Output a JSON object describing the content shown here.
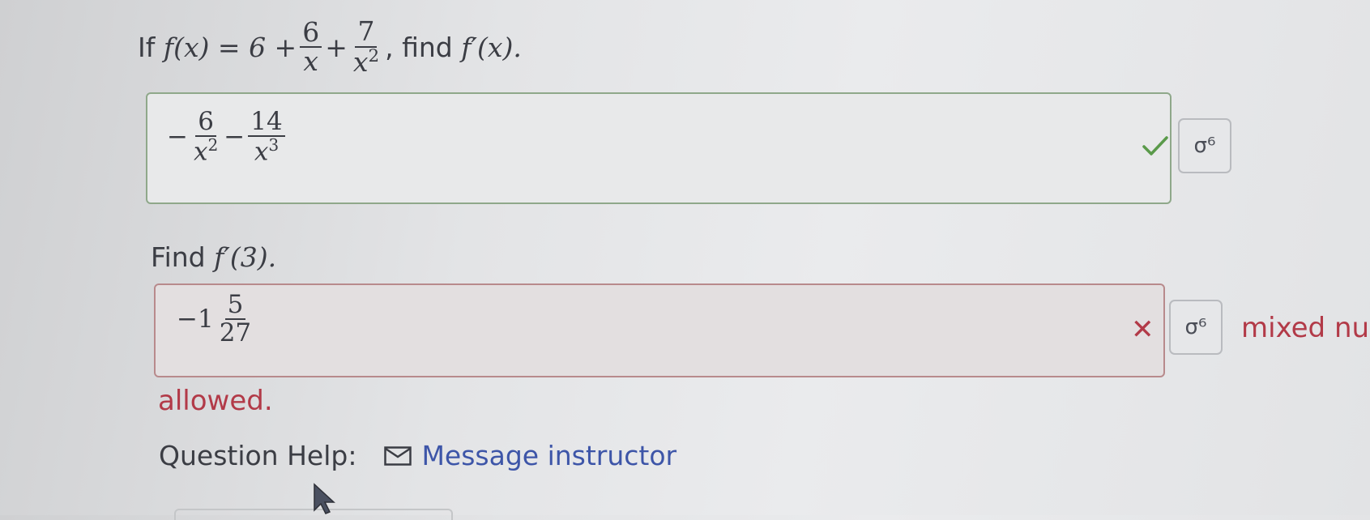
{
  "question1": {
    "prefix": "If",
    "fx": "f(x) = 6 +",
    "frac1_num": "6",
    "frac1_den": "x",
    "plus": "+",
    "frac2_num": "7",
    "frac2_den": "x",
    "frac2_den_exp": "2",
    "suffix_text": ", find",
    "suffix_math": "f′(x)."
  },
  "answer1": {
    "minus1": "−",
    "f1_num": "6",
    "f1_den": "x",
    "f1_exp": "2",
    "minus2": "−",
    "f2_num": "14",
    "f2_den": "x",
    "f2_exp": "3",
    "status": "correct"
  },
  "question2": {
    "text": "Find",
    "math": "f′(3)."
  },
  "answer2": {
    "whole": "−1",
    "num": "5",
    "den": "27",
    "status": "incorrect",
    "message_part1": "mixed nu",
    "message_part2": "allowed."
  },
  "help": {
    "label": "Question Help:",
    "link": "Message instructor",
    "icon": "mail-icon"
  },
  "colors": {
    "correct": "#5a9a4a",
    "incorrect": "#b23a48",
    "link": "#3d55a8"
  },
  "buttons": {
    "key_symbol": "σ⁶"
  }
}
